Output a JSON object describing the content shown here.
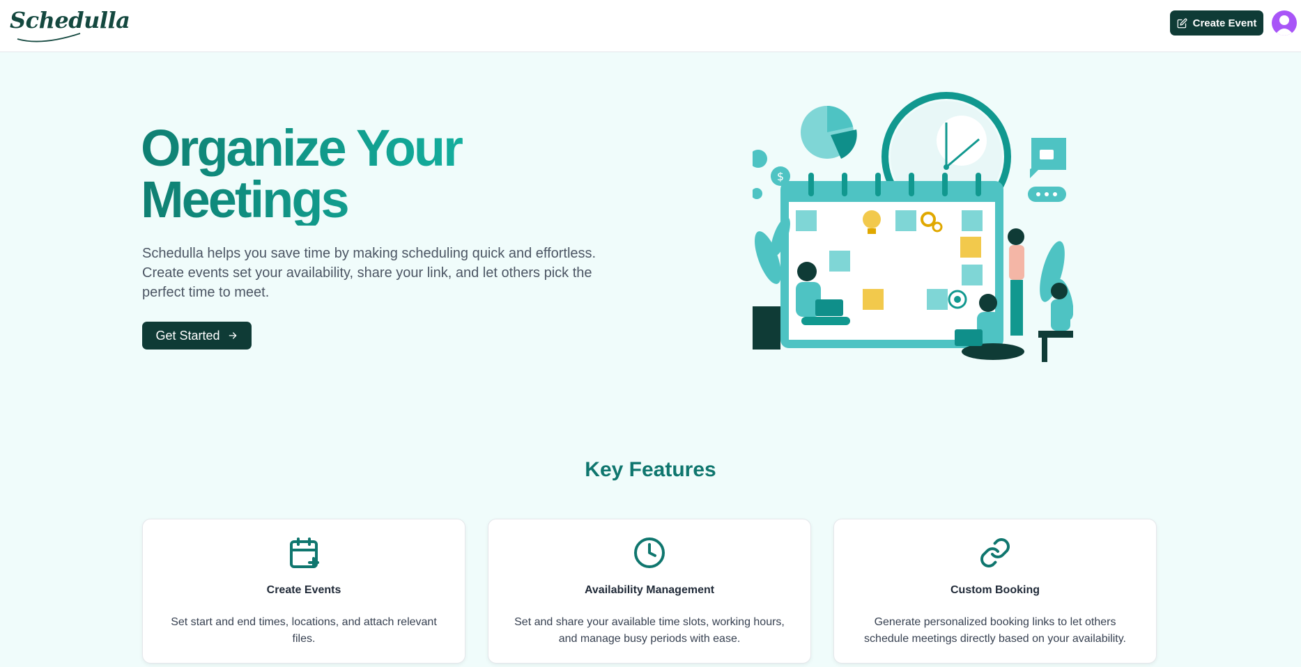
{
  "header": {
    "logo": "Schedulla",
    "create_event_label": "Create Event"
  },
  "hero": {
    "title_line1": "Organize Your",
    "title_line2": "Meetings",
    "description": "Schedulla helps you save time by making scheduling quick and effortless. Create events set your availability, share your link, and let others pick the perfect time to meet.",
    "cta_label": "Get Started",
    "cta_icon": "arrow-right-icon"
  },
  "features": {
    "title": "Key Features",
    "items": [
      {
        "icon": "calendar-plus-icon",
        "title": "Create Events",
        "description": "Set start and end times, locations, and attach relevant files."
      },
      {
        "icon": "clock-icon",
        "title": "Availability Management",
        "description": "Set and share your available time slots, working hours, and manage busy periods with ease."
      },
      {
        "icon": "link-icon",
        "title": "Custom Booking",
        "description": "Generate personalized booking links to let others schedule meetings directly based on your availability."
      }
    ]
  },
  "colors": {
    "brand_dark": "#0f3b36",
    "accent": "#0f766e",
    "background": "#f0fcfb",
    "avatar": "#a855f7"
  }
}
